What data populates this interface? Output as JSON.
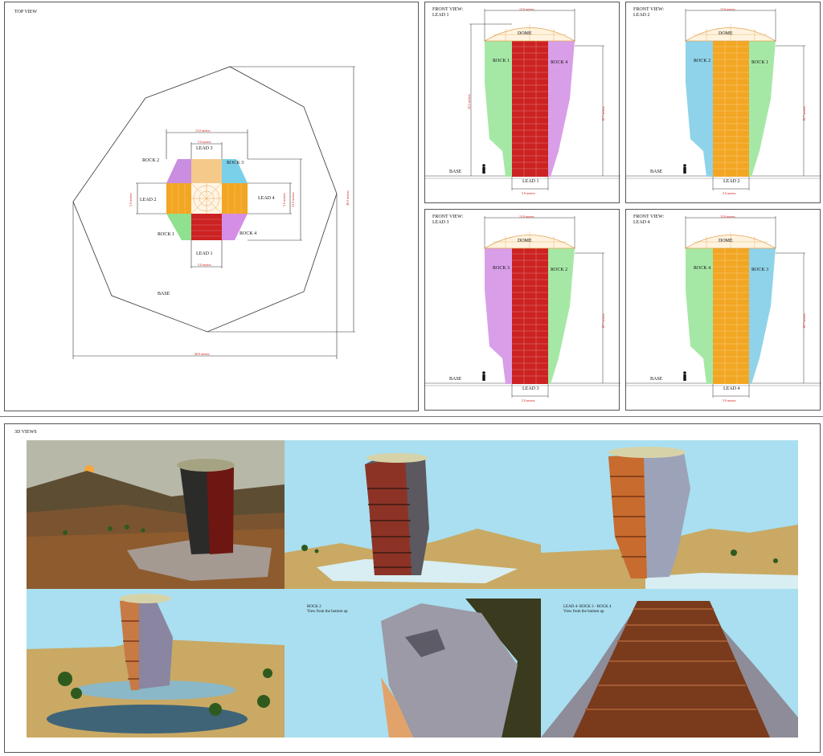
{
  "top_view": {
    "title": "TOP VIEW",
    "leads": {
      "l1": "LEAD 1",
      "l2": "LEAD 2",
      "l3": "LEAD 3",
      "l4": "LEAD 4"
    },
    "rocks": {
      "r1": "ROCK 1",
      "r2": "ROCK 2",
      "r3": "ROCK 3",
      "r4": "ROCK 4"
    },
    "base": "BASE",
    "dims": {
      "width13": "13.0 meters",
      "lead3w": "5.0 meters",
      "lead1w": "5.0 meters",
      "lead2h": "5.0 meters",
      "lead4h": "5.0 meters",
      "height13": "13.0 meters",
      "base40w": "40.0 meters",
      "base40h": "40.0 meters"
    }
  },
  "front_views": [
    {
      "title": "FRONT VIEW:\nLEAD 1",
      "dome": "DOME",
      "left": "ROCK 1",
      "right": "ROCK 4",
      "lead": "LEAD 1",
      "base": "BASE",
      "top": "13.0 meters",
      "left_h": "22.5 meters",
      "right_h": "18.7 meters",
      "bottom": "5.0 meters",
      "stripe": "#cc2222",
      "leftc": "#a5e8a5",
      "rightc": "#d99ee8"
    },
    {
      "title": "FRONT VIEW:\nLEAD 2",
      "dome": "DOME",
      "left": "ROCK 2",
      "right": "ROCK 1",
      "lead": "LEAD 2",
      "base": "BASE",
      "top": "13.0 meters",
      "left_h": "",
      "right_h": "18.7 meters",
      "bottom": "5.0 meters",
      "stripe": "#f2a623",
      "leftc": "#8fd3ea",
      "rightc": "#a5e8a5"
    },
    {
      "title": "FRONT VIEW:\nLEAD 3",
      "dome": "DOME",
      "left": "ROCK 3",
      "right": "ROCK 2",
      "lead": "LEAD 3",
      "base": "BASE",
      "top": "13.0 meters",
      "left_h": "",
      "right_h": "18.7 meters",
      "bottom": "5.0 meters",
      "stripe": "#cc2222",
      "leftc": "#d99ee8",
      "rightc": "#a5e8a5"
    },
    {
      "title": "FRONT VIEW:\nLEAD 4",
      "dome": "DOME",
      "left": "ROCK 4",
      "right": "ROCK 3",
      "lead": "LEAD 4",
      "base": "BASE",
      "top": "13.0 meters",
      "left_h": "",
      "right_h": "18.7 meters",
      "bottom": "5.0 meters",
      "stripe": "#f2a623",
      "leftc": "#a5e8a5",
      "rightc": "#8fd3ea"
    }
  ],
  "views_3d": {
    "title": "3D VIEWS",
    "cell5_caption": "ROCK 2\nView from the bottom up",
    "cell6_caption": "LEAD 4- ROCK 3 - ROCK 4\nView from the bottom up"
  },
  "colors": {
    "dim": "#d42020",
    "line": "#333333",
    "sky": "#a9dff0",
    "sand": "#c9a964",
    "ground": "#8a5a34"
  }
}
